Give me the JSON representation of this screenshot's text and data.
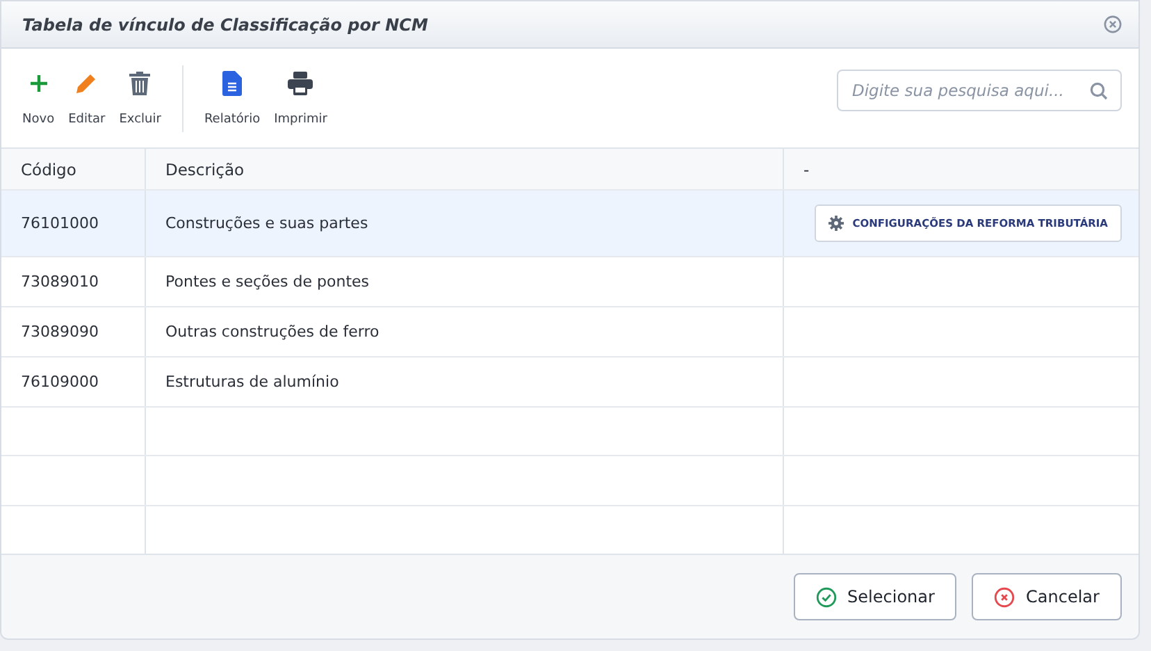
{
  "window": {
    "title": "Tabela de vínculo de Classificação por NCM"
  },
  "toolbar": [
    {
      "kind": "add",
      "label": "Novo"
    },
    {
      "kind": "edit",
      "label": "Editar"
    },
    {
      "kind": "delete",
      "label": "Excluir"
    },
    {
      "kind": "separator"
    },
    {
      "kind": "report",
      "label": "Relatório"
    },
    {
      "kind": "print",
      "label": "Imprimir"
    }
  ],
  "search": {
    "placeholder": "Digite sua pesquisa aqui..."
  },
  "table": {
    "columns": [
      "Código",
      "Descrição",
      "-"
    ],
    "rows": [
      {
        "code": "76101000",
        "description": "Construções e suas partes",
        "selected": true,
        "action": "CONFIGURAÇÕES DA REFORMA TRIBUTÁRIA"
      },
      {
        "code": "73089010",
        "description": "Pontes e seções de pontes",
        "selected": false
      },
      {
        "code": "73089090",
        "description": "Outras construções de ferro",
        "selected": false
      },
      {
        "code": "76109000",
        "description": "Estruturas de alumínio",
        "selected": false
      }
    ]
  },
  "buttons": [
    {
      "kind": "confirm",
      "label": "Selecionar"
    },
    {
      "kind": "cancel",
      "label": "Cancelar"
    }
  ]
}
